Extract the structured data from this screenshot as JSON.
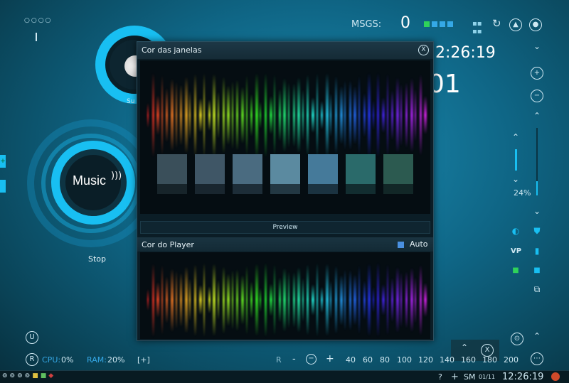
{
  "header": {
    "msgs_label": "MSGS:",
    "msgs_count": "0",
    "clock": "12:26:19",
    "clock_prefix": "1",
    "date": "01",
    "status_colors": [
      "#2fd25a",
      "#35a8e6",
      "#35a8e6",
      "#35a8e6"
    ]
  },
  "left": {
    "top_ring_label": "Su",
    "music_label": "Music",
    "stop_label": "Stop",
    "dots": "○○○○"
  },
  "dialog": {
    "title": "Cor das janelas",
    "close": "X",
    "preview_label": "Preview",
    "player_title": "Cor do Player",
    "auto_label": "Auto",
    "swatch_colors": [
      "#3a4f5a",
      "#3f5666",
      "#4a6b80",
      "#5b8aa0",
      "#457a9a",
      "#2a6a6a",
      "#2c5a50"
    ]
  },
  "right": {
    "volume_percent": "24%",
    "vp_label": "VP",
    "volume_level": 0.24
  },
  "bottom": {
    "cpu_label": "CPU:",
    "cpu_value": "0%",
    "ram_label": "RAM:",
    "ram_value": "20%",
    "expand": "[+]",
    "r_label": "R",
    "minus": "-",
    "plus": "+",
    "speeds": [
      "40",
      "60",
      "80",
      "100",
      "120",
      "140",
      "160",
      "180",
      "200"
    ]
  },
  "taskbar": {
    "help": "?",
    "plus": "+",
    "sm": "SM",
    "date_small": "01/11",
    "clock": "12:26:19"
  },
  "icons": {
    "close": "close-icon",
    "refresh": "refresh-icon",
    "grid": "grid-icon"
  }
}
